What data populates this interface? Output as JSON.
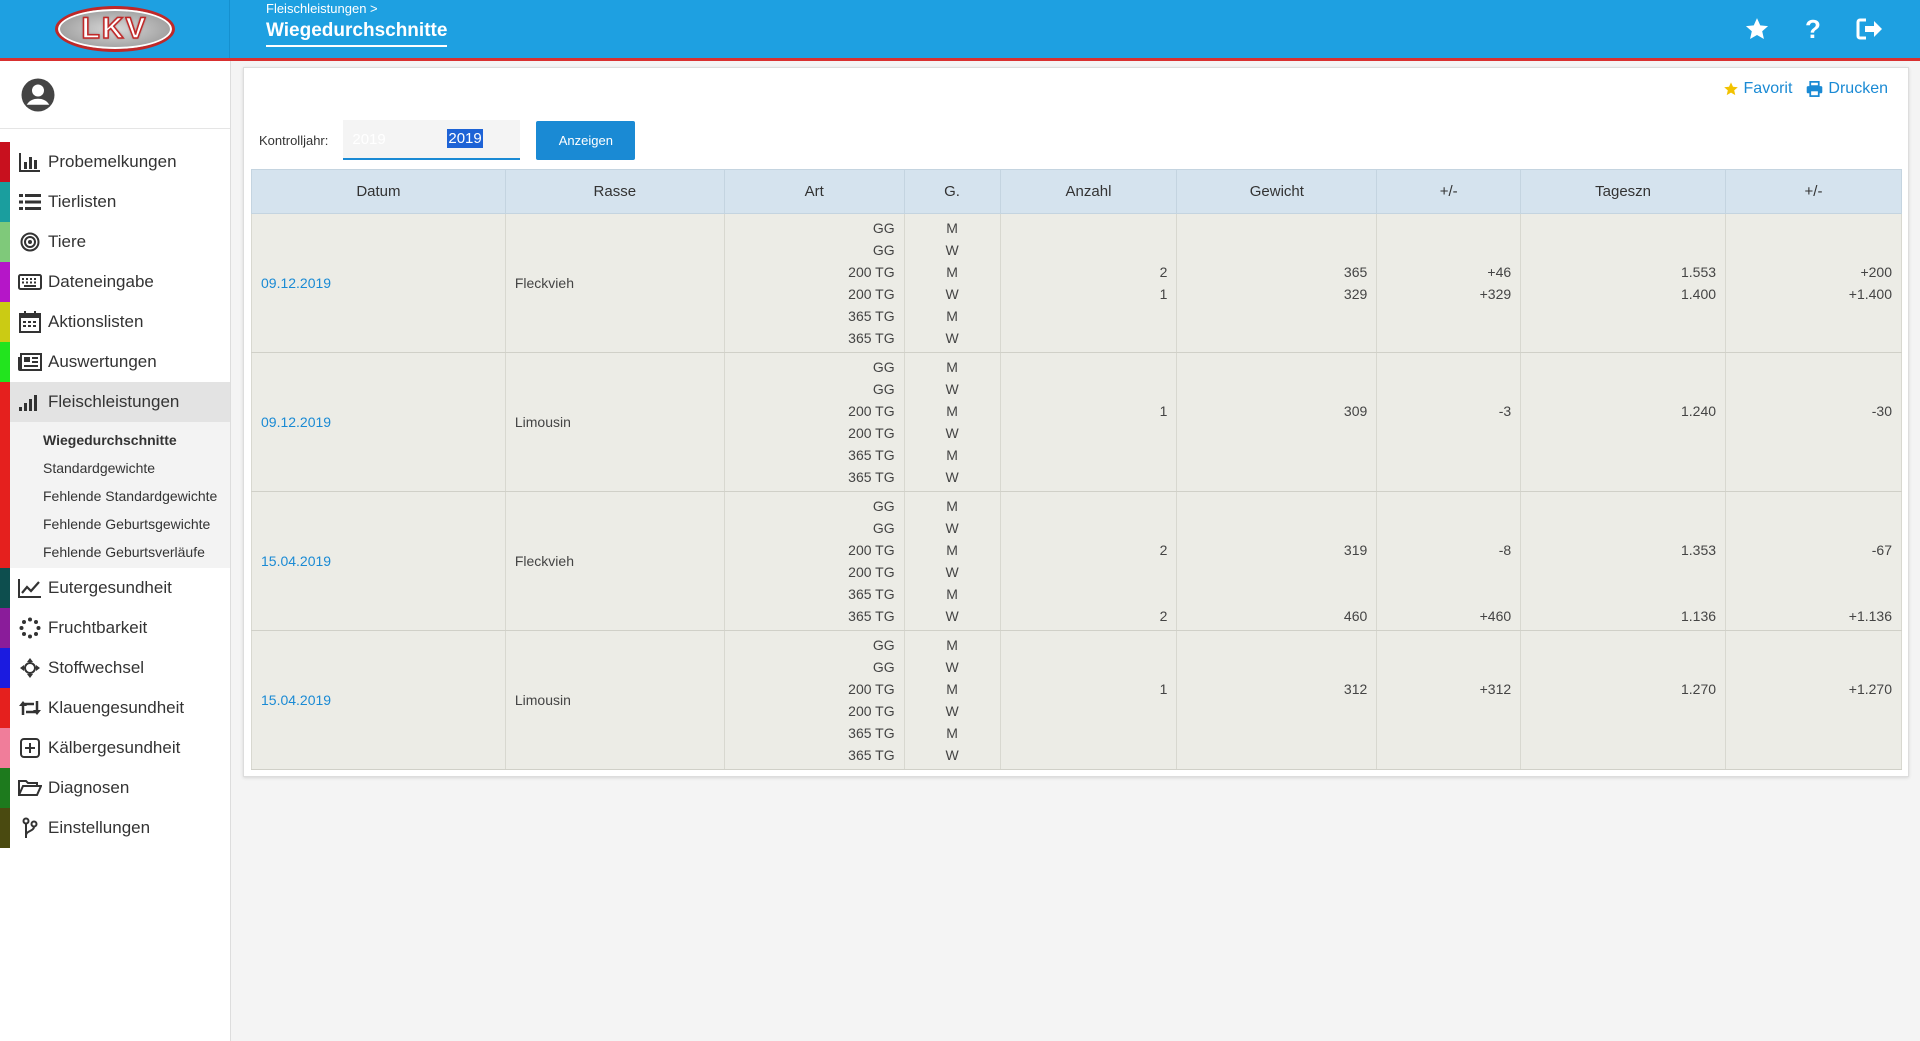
{
  "header": {
    "breadcrumb": "Fleischleistungen >",
    "title": "Wiegedurchschnitte",
    "logo_text": "LKV"
  },
  "sidebar": {
    "items": [
      {
        "label": "Probemelkungen",
        "color": "#c8101e",
        "icon": "bar-chart-icon"
      },
      {
        "label": "Tierlisten",
        "color": "#1a9e9e",
        "icon": "list-icon"
      },
      {
        "label": "Tiere",
        "color": "#7fc97a",
        "icon": "target-icon"
      },
      {
        "label": "Dateneingabe",
        "color": "#b516c8",
        "icon": "keyboard-icon"
      },
      {
        "label": "Aktionslisten",
        "color": "#cbcb14",
        "icon": "calendar-icon"
      },
      {
        "label": "Auswertungen",
        "color": "#22e41e",
        "icon": "newspaper-icon"
      },
      {
        "label": "Fleischleistungen",
        "color": "#e5201e",
        "icon": "signal-icon"
      }
    ],
    "sub_items": [
      "Wiegedurchschnitte",
      "Standardgewichte",
      "Fehlende Standardgewichte",
      "Fehlende Geburtsgewichte",
      "Fehlende Geburtsverläufe"
    ],
    "items_after": [
      {
        "label": "Eutergesundheit",
        "color": "#0d4e4e",
        "icon": "line-chart-icon"
      },
      {
        "label": "Fruchtbarkeit",
        "color": "#8a1c9a",
        "icon": "dots-circle-icon"
      },
      {
        "label": "Stoffwechsel",
        "color": "#1b1be0",
        "icon": "crosshair-icon"
      },
      {
        "label": "Klauengesundheit",
        "color": "#e5201e",
        "icon": "retweet-icon"
      },
      {
        "label": "Kälbergesundheit",
        "color": "#f07d9a",
        "icon": "plus-square-icon"
      },
      {
        "label": "Diagnosen",
        "color": "#1d7a1d",
        "icon": "folder-open-icon"
      },
      {
        "label": "Einstellungen",
        "color": "#4a4a10",
        "icon": "branch-icon"
      }
    ]
  },
  "actions": {
    "favorite": "Favorit",
    "print": "Drucken"
  },
  "filter": {
    "label": "Kontrolljahr:",
    "value": "2019",
    "button": "Anzeigen"
  },
  "table": {
    "headers": [
      "Datum",
      "Rasse",
      "Art",
      "G.",
      "Anzahl",
      "Gewicht",
      "+/-",
      "Tageszn",
      "+/-"
    ],
    "groups": [
      {
        "datum": "09.12.2019",
        "rasse": "Fleckvieh",
        "rows": [
          {
            "art": "GG",
            "g": "M",
            "anzahl": "",
            "gewicht": "",
            "diff": "",
            "tageszn": "",
            "diff2": ""
          },
          {
            "art": "GG",
            "g": "W",
            "anzahl": "",
            "gewicht": "",
            "diff": "",
            "tageszn": "",
            "diff2": ""
          },
          {
            "art": "200 TG",
            "g": "M",
            "anzahl": "2",
            "gewicht": "365",
            "diff": "+46",
            "tageszn": "1.553",
            "diff2": "+200"
          },
          {
            "art": "200 TG",
            "g": "W",
            "anzahl": "1",
            "gewicht": "329",
            "diff": "+329",
            "tageszn": "1.400",
            "diff2": "+1.400"
          },
          {
            "art": "365 TG",
            "g": "M",
            "anzahl": "",
            "gewicht": "",
            "diff": "",
            "tageszn": "",
            "diff2": ""
          },
          {
            "art": "365 TG",
            "g": "W",
            "anzahl": "",
            "gewicht": "",
            "diff": "",
            "tageszn": "",
            "diff2": ""
          }
        ]
      },
      {
        "datum": "09.12.2019",
        "rasse": "Limousin",
        "rows": [
          {
            "art": "GG",
            "g": "M",
            "anzahl": "",
            "gewicht": "",
            "diff": "",
            "tageszn": "",
            "diff2": ""
          },
          {
            "art": "GG",
            "g": "W",
            "anzahl": "",
            "gewicht": "",
            "diff": "",
            "tageszn": "",
            "diff2": ""
          },
          {
            "art": "200 TG",
            "g": "M",
            "anzahl": "1",
            "gewicht": "309",
            "diff": "-3",
            "tageszn": "1.240",
            "diff2": "-30"
          },
          {
            "art": "200 TG",
            "g": "W",
            "anzahl": "",
            "gewicht": "",
            "diff": "",
            "tageszn": "",
            "diff2": ""
          },
          {
            "art": "365 TG",
            "g": "M",
            "anzahl": "",
            "gewicht": "",
            "diff": "",
            "tageszn": "",
            "diff2": ""
          },
          {
            "art": "365 TG",
            "g": "W",
            "anzahl": "",
            "gewicht": "",
            "diff": "",
            "tageszn": "",
            "diff2": ""
          }
        ]
      },
      {
        "datum": "15.04.2019",
        "rasse": "Fleckvieh",
        "rows": [
          {
            "art": "GG",
            "g": "M",
            "anzahl": "",
            "gewicht": "",
            "diff": "",
            "tageszn": "",
            "diff2": ""
          },
          {
            "art": "GG",
            "g": "W",
            "anzahl": "",
            "gewicht": "",
            "diff": "",
            "tageszn": "",
            "diff2": ""
          },
          {
            "art": "200 TG",
            "g": "M",
            "anzahl": "2",
            "gewicht": "319",
            "diff": "-8",
            "tageszn": "1.353",
            "diff2": "-67"
          },
          {
            "art": "200 TG",
            "g": "W",
            "anzahl": "",
            "gewicht": "",
            "diff": "",
            "tageszn": "",
            "diff2": ""
          },
          {
            "art": "365 TG",
            "g": "M",
            "anzahl": "",
            "gewicht": "",
            "diff": "",
            "tageszn": "",
            "diff2": ""
          },
          {
            "art": "365 TG",
            "g": "W",
            "anzahl": "2",
            "gewicht": "460",
            "diff": "+460",
            "tageszn": "1.136",
            "diff2": "+1.136"
          }
        ]
      },
      {
        "datum": "15.04.2019",
        "rasse": "Limousin",
        "rows": [
          {
            "art": "GG",
            "g": "M",
            "anzahl": "",
            "gewicht": "",
            "diff": "",
            "tageszn": "",
            "diff2": ""
          },
          {
            "art": "GG",
            "g": "W",
            "anzahl": "",
            "gewicht": "",
            "diff": "",
            "tageszn": "",
            "diff2": ""
          },
          {
            "art": "200 TG",
            "g": "M",
            "anzahl": "1",
            "gewicht": "312",
            "diff": "+312",
            "tageszn": "1.270",
            "diff2": "+1.270"
          },
          {
            "art": "200 TG",
            "g": "W",
            "anzahl": "",
            "gewicht": "",
            "diff": "",
            "tageszn": "",
            "diff2": ""
          },
          {
            "art": "365 TG",
            "g": "M",
            "anzahl": "",
            "gewicht": "",
            "diff": "",
            "tageszn": "",
            "diff2": ""
          },
          {
            "art": "365 TG",
            "g": "W",
            "anzahl": "",
            "gewicht": "",
            "diff": "",
            "tageszn": "",
            "diff2": ""
          }
        ]
      }
    ]
  },
  "colors": {
    "brand": "#1ea0e1",
    "accent_red": "#d83030",
    "link": "#1a8ad4",
    "header_row": "#d5e3ee",
    "body_row": "#ecece6"
  }
}
